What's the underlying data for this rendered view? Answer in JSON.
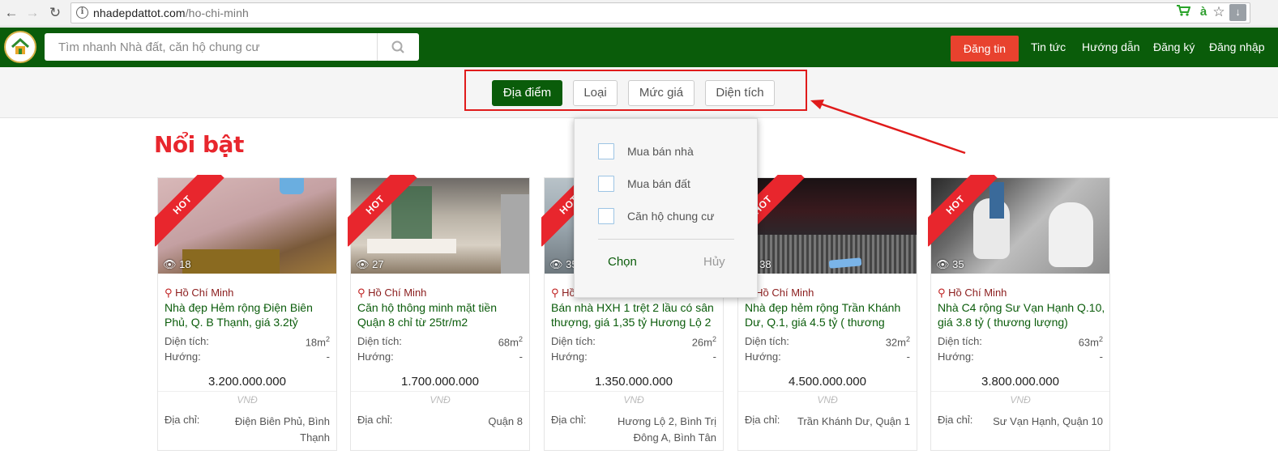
{
  "browser": {
    "url_host": "nhadepdattot.com",
    "url_path": "/ho-chi-minh"
  },
  "header": {
    "search_placeholder": "Tìm nhanh Nhà đất, căn hộ chung cư",
    "post_label": "Đăng tin",
    "links": [
      "Tin tức",
      "Hướng dẫn",
      "Đăng ký",
      "Đăng nhập"
    ]
  },
  "filters": [
    "Địa điểm",
    "Loại",
    "Mức giá",
    "Diện tích"
  ],
  "section_title": "Nổi bật",
  "dropdown": {
    "options": [
      "Mua bán nhà",
      "Mua bán đất",
      "Căn hộ chung cư"
    ],
    "choose_label": "Chọn",
    "cancel_label": "Hủy"
  },
  "card_labels": {
    "hot": "HOT",
    "area": "Diện tích:",
    "direction": "Hướng:",
    "currency": "VNĐ",
    "address": "Địa chỉ:"
  },
  "cards": [
    {
      "views": "18",
      "location": "Hồ Chí Minh",
      "title": "Nhà đẹp Hẻm rộng Điện Biên Phủ, Q. B Thạnh, giá 3.2tỷ",
      "area": "18m",
      "direction": "-",
      "price": "3.200.000.000",
      "address": "Điện Biên Phủ, Bình Thạnh"
    },
    {
      "views": "27",
      "location": "Hồ Chí Minh",
      "title": "Căn hộ thông minh mặt tiền Quận 8 chỉ từ 25tr/m2",
      "area": "68m",
      "direction": "-",
      "price": "1.700.000.000",
      "address": "Quận 8"
    },
    {
      "views": "35",
      "location": "Hồ Chí Minh",
      "title": "Bán nhà HXH 1 trệt 2 lầu có sân thượng, giá 1,35 tỷ Hương Lộ 2",
      "area": "26m",
      "direction": "-",
      "price": "1.350.000.000",
      "address": "Hương Lộ 2, Bình Trị Đông A, Bình Tân"
    },
    {
      "views": "38",
      "location": "Hồ Chí Minh",
      "title": "Nhà đẹp hẻm rộng Trần Khánh Dư, Q.1, giá 4.5 tỷ ( thương",
      "area": "32m",
      "direction": "-",
      "price": "4.500.000.000",
      "address": "Trần Khánh Dư, Quận 1"
    },
    {
      "views": "35",
      "location": "Hồ Chí Minh",
      "title": "Nhà C4 rộng Sư Vạn Hạnh Q.10, giá 3.8 tỷ ( thương lượng)",
      "area": "63m",
      "direction": "-",
      "price": "3.800.000.000",
      "address": "Sư Vạn Hạnh, Quận 10"
    }
  ],
  "colors": {
    "brand_green": "#0a5c0a",
    "hot_red": "#e8262d",
    "post_button": "#e8422e",
    "annotation_red": "#e01b1b"
  }
}
